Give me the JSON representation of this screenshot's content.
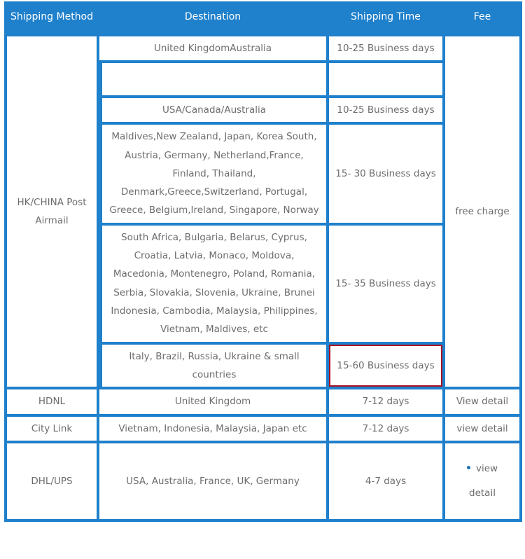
{
  "table": {
    "headers": {
      "method": "Shipping Method",
      "destination": "Destination",
      "time": "Shipping Time",
      "fee": "Fee"
    },
    "colors": {
      "border_blue": "#1f80cc",
      "header_bg": "#1f80cc",
      "header_text": "#ffffff",
      "cell_text": "#6d6d6d",
      "highlight_red_text": "#cc3333",
      "highlight_red_border": "#aa1122",
      "bullet_blue": "#1f6fb5",
      "cell_bg": "#ffffff"
    },
    "groups": [
      {
        "method": "HK/CHINA Post Airmail",
        "fee": "free charge",
        "rows": [
          {
            "destination": "United KingdomAustralia",
            "time": "10-25 Business days",
            "highlight": false
          },
          {
            "destination": "",
            "time": "",
            "highlight": false
          },
          {
            "destination": "USA/Canada/Australia",
            "time": "10-25 Business days",
            "highlight": false
          },
          {
            "destination": "Maldives,New Zealand, Japan, Korea South, Austria, Germany, Netherland,France, Finland, Thailand, Denmark,Greece,Switzerland, Portugal, Greece, Belgium,Ireland, Singapore, Norway",
            "time": "15- 30 Business days",
            "highlight": false
          },
          {
            "destination": "South Africa, Bulgaria, Belarus, Cyprus, Croatia, Latvia, Monaco, Moldova, Macedonia, Montenegro, Poland, Romania, Serbia, Slovakia, Slovenia, Ukraine, Brunei Indonesia, Cambodia, Malaysia, Philippines, Vietnam, Maldives, etc",
            "time": "15- 35 Business days",
            "highlight": false
          },
          {
            "destination": "Italy, Brazil, Russia, Ukraine & small countries",
            "time": "15-60 Business days",
            "highlight": true
          }
        ]
      }
    ],
    "simple_rows": [
      {
        "method": "HDNL",
        "destination": "United Kingdom",
        "time": "7-12 days",
        "fee": "View detail"
      },
      {
        "method": "City Link",
        "destination": "Vietnam, Indonesia, Malaysia, Japan etc",
        "time": "7-12 days",
        "fee": "view detail"
      }
    ],
    "dhl_row": {
      "method": "DHL/UPS",
      "destination": "USA, Australia, France, UK, Germany",
      "time": "4-7 days",
      "fee_line1": "view",
      "fee_line2": "detail"
    }
  }
}
